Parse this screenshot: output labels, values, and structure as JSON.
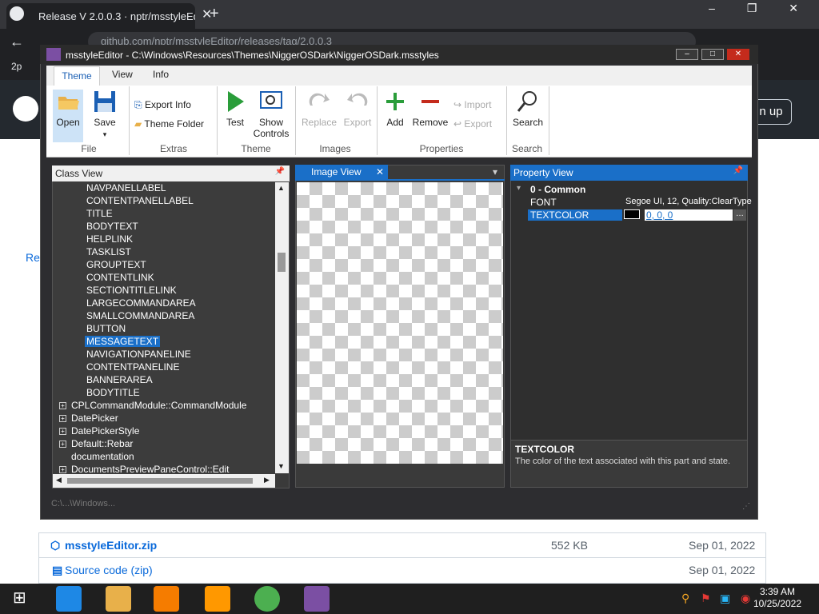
{
  "browser": {
    "tab_title": "Release V 2.0.0.3 · nptr/msstyleEd",
    "tab_close": "✕",
    "new_tab": "+",
    "window_controls": "‒ ❐ ✕",
    "address": "github.com/nptr/msstyleEditor/releases/tag/2.0.0.3",
    "bookmark": "2p"
  },
  "github": {
    "signup": "n up",
    "releases_link": "Rel",
    "assets": [
      {
        "name": "msstyleEditor.zip",
        "size": "552 KB",
        "date": "Sep 01, 2022"
      },
      {
        "name": "Source code",
        "suffix": "(zip)",
        "size": "",
        "date": "Sep 01, 2022"
      }
    ]
  },
  "app": {
    "title": "msstyleEditor - C:\\Windows\\Resources\\Themes\\NiggerOSDark\\NiggerOSDark.msstyles",
    "ribbon_tabs": [
      "Theme",
      "View",
      "Info"
    ],
    "ribbon": {
      "open": "Open",
      "save": "Save",
      "save_arrow": "▾",
      "export_info": "Export Info",
      "theme_folder": "Theme Folder",
      "test": "Test",
      "show_controls_1": "Show",
      "show_controls_2": "Controls",
      "replace": "Replace",
      "export": "Export",
      "add": "Add",
      "remove": "Remove",
      "import_prop": "Import",
      "export_prop": "Export",
      "search": "Search",
      "groups": [
        "File",
        "Extras",
        "Theme",
        "Images",
        "Properties",
        "Search"
      ]
    },
    "class_view": {
      "title": "Class View",
      "pin": "📌",
      "children": [
        "NAVPANELLABEL",
        "CONTENTPANELLABEL",
        "TITLE",
        "BODYTEXT",
        "HELPLINK",
        "TASKLIST",
        "GROUPTEXT",
        "CONTENTLINK",
        "SECTIONTITLELINK",
        "LARGECOMMANDAREA",
        "SMALLCOMMANDAREA",
        "BUTTON",
        "MESSAGETEXT",
        "NAVIGATIONPANELINE",
        "CONTENTPANELINE",
        "BANNERAREA",
        "BODYTITLE"
      ],
      "selected": "MESSAGETEXT",
      "classes": [
        "CPLCommandModule::CommandModule",
        "DatePicker",
        "DatePickerStyle",
        "Default::Rebar",
        "documentation",
        "DocumentsPreviewPaneControl::Edit"
      ],
      "expanders": [
        "+",
        "+",
        "+",
        "+",
        "",
        "+"
      ]
    },
    "image_view": {
      "title": "Image View",
      "close": "✕",
      "dropdown": "▾"
    },
    "property_view": {
      "title": "Property View",
      "pin": "📌",
      "category_toggle": "▾",
      "category": "0 - Common",
      "props": [
        {
          "name": "FONT",
          "value": "Segoe UI, 12, Quality:ClearType"
        },
        {
          "name": "TEXTCOLOR",
          "value": "0, 0, 0"
        }
      ],
      "swatch_color": "#000000",
      "ellipsis": "…",
      "desc_title": "TEXTCOLOR",
      "desc_text": "The color of the text associated with this part and state."
    },
    "status": "C:\\...\\Windows..."
  },
  "taskbar": {
    "time": "3:39 AM",
    "date": "10/25/2022"
  },
  "colors": {
    "accent": "#1a6fc8",
    "ribbon_bg": "#ffffff",
    "panel_bg": "#3c3c3c"
  }
}
